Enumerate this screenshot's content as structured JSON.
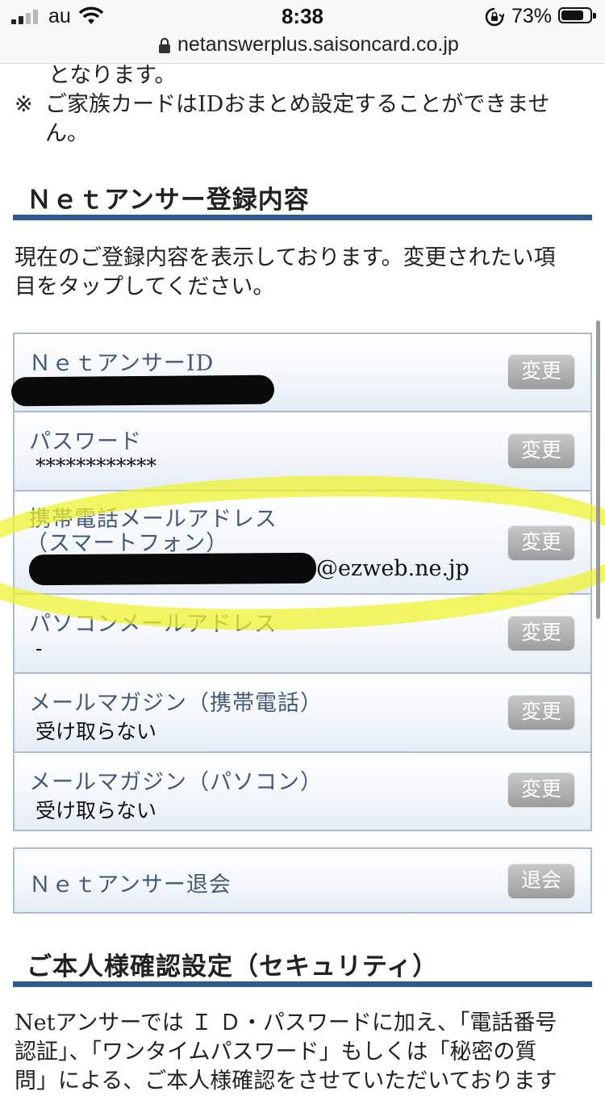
{
  "status_bar": {
    "carrier": "au",
    "time": "8:38",
    "battery": "73%"
  },
  "browser": {
    "url": "netanswerplus.saisoncard.co.jp"
  },
  "notes": {
    "line0": "となります。",
    "mark": "※",
    "line1": "ご家族カードはIDおまとめ設定することができませ",
    "line2": "ん。"
  },
  "section1": {
    "title": "Ｎｅｔアンサー登録内容",
    "desc1": "現在のご登録内容を表示しております。変更されたい項",
    "desc2": "目をタップしてください。"
  },
  "rows": [
    {
      "label": "ＮｅｔアンサーID",
      "value": "",
      "button": "変更"
    },
    {
      "label": "パスワード",
      "value": "************",
      "button": "変更"
    },
    {
      "label": "携帯電話メールアドレス",
      "label2": "（スマートフォン）",
      "value": "@ezweb.ne.jp",
      "button": "変更"
    },
    {
      "label": "パソコンメールアドレス",
      "value": "-",
      "button": "変更"
    },
    {
      "label": "メールマガジン（携帯電話）",
      "value": "受け取らない",
      "button": "変更"
    },
    {
      "label": "メールマガジン（パソコン）",
      "value": "受け取らない",
      "button": "変更"
    }
  ],
  "withdraw": {
    "label": "Ｎｅｔアンサー退会",
    "button": "退会"
  },
  "section2": {
    "title": "ご本人様確認設定（セキュリティ）",
    "line1": "Netアンサーでは Ｉ Ｄ・パスワードに加え、「電話番号",
    "line2": "認証」、「ワンタイムパスワード」もしくは「秘密の質",
    "line3": "問」による、ご本人様確認をさせていただいております"
  },
  "colors": {
    "accent_rule": "#2e5a8f",
    "label_text": "#44597a",
    "highlight": "#eef228",
    "button_gray": "#a8a8a8"
  }
}
